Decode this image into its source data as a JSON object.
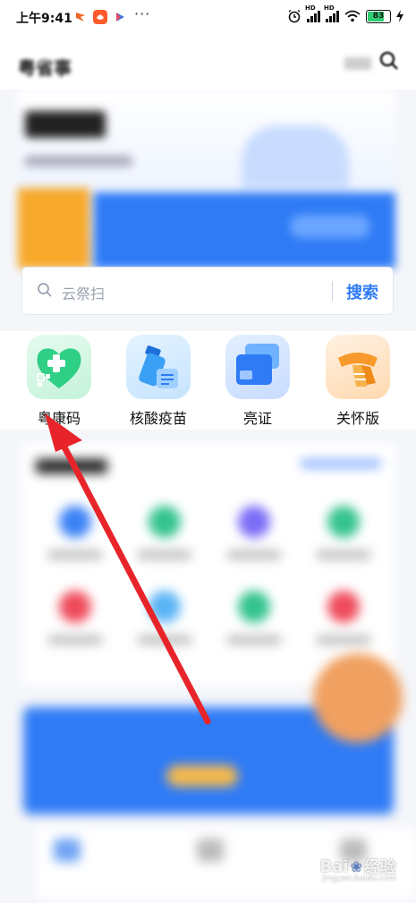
{
  "status_bar": {
    "time": "上午9:41",
    "dots": "···",
    "battery": "83"
  },
  "header": {
    "title": "粤省事"
  },
  "search": {
    "placeholder": "云祭扫",
    "button_label": "搜索"
  },
  "quick_tiles": [
    {
      "label": "粤康码",
      "icon": "health-code-heart-icon",
      "color": "#2fcf86"
    },
    {
      "label": "核酸疫苗",
      "icon": "nucleic-vaccine-icon",
      "color": "#3aa0f5"
    },
    {
      "label": "亮证",
      "icon": "id-cards-icon",
      "color": "#2f7bf5"
    },
    {
      "label": "关怀版",
      "icon": "care-scarf-icon",
      "color": "#f79a2b"
    }
  ],
  "watermark": {
    "brand": "Bai",
    "brand_suffix": "经验",
    "url": "jingyan.baidu.com"
  },
  "colors": {
    "accent": "#2f7bf5",
    "arrow": "#e8242b"
  }
}
